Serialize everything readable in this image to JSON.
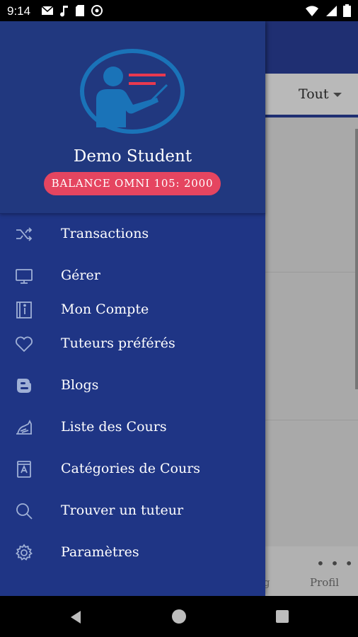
{
  "status_bar": {
    "time": "9:14"
  },
  "app": {
    "filter_label": "Tout",
    "bottom_nav": {
      "profile_label": "Profil",
      "partial_label": "g"
    }
  },
  "drawer": {
    "user_name": "Demo Student",
    "balance": "BALANCE OMNI 105: 2000",
    "menu": [
      {
        "label": "Transactions",
        "icon": "shuffle-icon"
      },
      {
        "label": "Gérer",
        "icon": "monitor-icon"
      },
      {
        "label": "Mon Compte",
        "icon": "account-book-icon"
      },
      {
        "label": "Tuteurs préférés",
        "icon": "heart-icon"
      },
      {
        "label": "Blogs",
        "icon": "blogger-icon"
      },
      {
        "label": "Liste des Cours",
        "icon": "course-list-icon"
      },
      {
        "label": "Catégories de Cours",
        "icon": "category-book-icon"
      },
      {
        "label": "Trouver un tuteur",
        "icon": "search-icon"
      },
      {
        "label": "Paramètres",
        "icon": "gear-icon"
      }
    ]
  },
  "colors": {
    "drawer_bg": "#1f3585",
    "app_header": "#1f2f72",
    "balance_pill": "#e54560",
    "logo_ring": "#1a73b8",
    "logo_lines": "#e8394f"
  }
}
